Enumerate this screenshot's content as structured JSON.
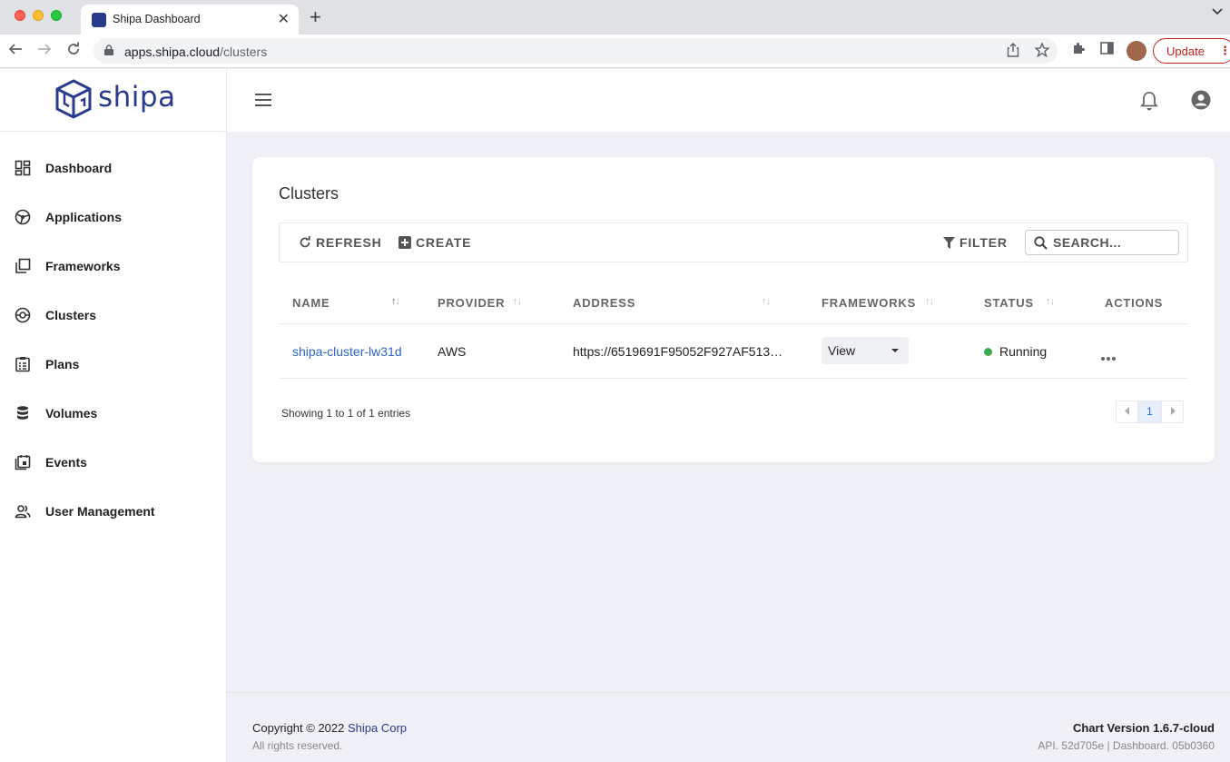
{
  "browser": {
    "tab_title": "Shipa Dashboard",
    "tab_close": "✕",
    "new_tab": "+",
    "url_host": "apps.shipa.cloud",
    "url_path": "/clusters",
    "update_label": "Update"
  },
  "sidebar": {
    "logo_text": "shipa",
    "items": [
      {
        "label": "Dashboard",
        "icon": "dashboard-icon"
      },
      {
        "label": "Applications",
        "icon": "applications-icon"
      },
      {
        "label": "Frameworks",
        "icon": "frameworks-icon"
      },
      {
        "label": "Clusters",
        "icon": "clusters-icon"
      },
      {
        "label": "Plans",
        "icon": "plans-icon"
      },
      {
        "label": "Volumes",
        "icon": "volumes-icon"
      },
      {
        "label": "Events",
        "icon": "events-icon"
      },
      {
        "label": "User Management",
        "icon": "user-management-icon"
      }
    ]
  },
  "card": {
    "title": "Clusters",
    "toolbar": {
      "refresh": "REFRESH",
      "create": "CREATE",
      "filter": "FILTER",
      "search_placeholder": "SEARCH..."
    },
    "columns": [
      "NAME",
      "PROVIDER",
      "ADDRESS",
      "FRAMEWORKS",
      "STATUS",
      "ACTIONS"
    ],
    "rows": [
      {
        "name": "shipa-cluster-lw31d",
        "provider": "AWS",
        "address": "https://6519691F95052F927AF513…",
        "frameworks": "View",
        "status": "Running"
      }
    ],
    "entries_info": "Showing 1 to 1 of 1 entries",
    "pagination": {
      "current": "1"
    }
  },
  "footer": {
    "copyright_prefix": "Copyright © 2022 ",
    "company": "Shipa Corp",
    "rights": "All rights reserved.",
    "chart_version": "Chart Version 1.6.7-cloud",
    "api_version": "API. 52d705e | Dashboard. 05b0360"
  },
  "colors": {
    "brand": "#2a3a8c",
    "link": "#2a65c9",
    "status_running": "#3dab4f",
    "background": "#f0f1f6"
  }
}
